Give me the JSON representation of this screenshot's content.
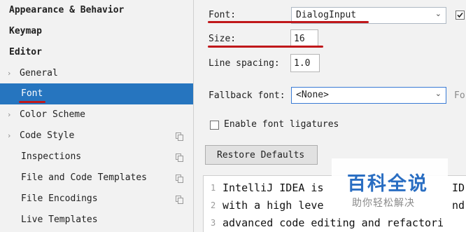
{
  "sidebar": {
    "items": [
      {
        "label": "Appearance & Behavior",
        "bold": true
      },
      {
        "label": "Keymap",
        "bold": true
      },
      {
        "label": "Editor",
        "bold": true
      },
      {
        "label": "General"
      },
      {
        "label": "Font",
        "selected": true
      },
      {
        "label": "Color Scheme"
      },
      {
        "label": "Code Style"
      },
      {
        "label": "Inspections"
      },
      {
        "label": "File and Code Templates"
      },
      {
        "label": "File Encodings"
      },
      {
        "label": "Live Templates"
      }
    ]
  },
  "font_settings": {
    "font_label": "Font:",
    "font_value": "DialogInput",
    "size_label": "Size:",
    "size_value": "16",
    "line_spacing_label": "Line spacing:",
    "line_spacing_value": "1.0",
    "fallback_label": "Fallback font:",
    "fallback_value": "<None>",
    "fallback_trailing": "Fo",
    "ligatures_label": "Enable font ligatures",
    "ligatures_checked": false,
    "restore_label": "Restore Defaults"
  },
  "preview": {
    "lines": [
      {
        "num": "1",
        "text": "IntelliJ IDEA is",
        "tail": "ID"
      },
      {
        "num": "2",
        "text": "with a high leve",
        "tail": "nd"
      },
      {
        "num": "3",
        "text": "advanced code editing and refactori",
        "tail": ""
      }
    ]
  },
  "watermark": {
    "title": "百科全说",
    "subtitle": "助你轻松解决"
  },
  "colors": {
    "selection": "#2675bf",
    "annotation": "#c0181b"
  }
}
